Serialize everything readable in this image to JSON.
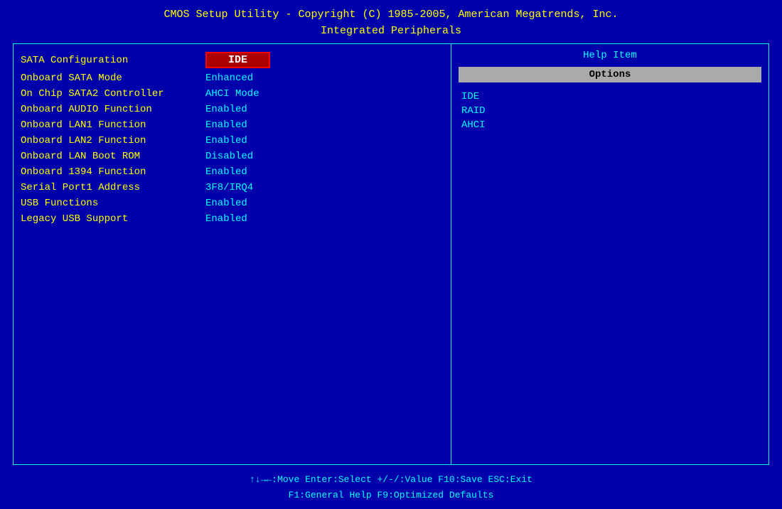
{
  "header": {
    "line1": "CMOS Setup Utility - Copyright (C) 1985-2005, American Megatrends, Inc.",
    "line2": "Integrated Peripherals"
  },
  "menu": {
    "items": [
      {
        "label": "SATA Configuration",
        "value": "IDE",
        "selected": true
      },
      {
        "label": "Onboard SATA Mode",
        "value": "Enhanced",
        "selected": false
      },
      {
        "label": "On Chip SATA2 Controller",
        "value": "AHCI Mode",
        "selected": false
      },
      {
        "label": "Onboard AUDIO Function",
        "value": "Enabled",
        "selected": false
      },
      {
        "label": "Onboard LAN1 Function",
        "value": "Enabled",
        "selected": false
      },
      {
        "label": "Onboard LAN2 Function",
        "value": "Enabled",
        "selected": false
      },
      {
        "label": "Onboard LAN Boot ROM",
        "value": "Disabled",
        "selected": false
      },
      {
        "label": "Onboard 1394 Function",
        "value": "Enabled",
        "selected": false
      },
      {
        "label": "Serial Port1 Address",
        "value": "3F8/IRQ4",
        "selected": false
      },
      {
        "label": "USB Functions",
        "value": "Enabled",
        "selected": false
      },
      {
        "label": "Legacy USB Support",
        "value": "Enabled",
        "selected": false
      }
    ]
  },
  "help_panel": {
    "title": "Help Item",
    "options_label": "Options",
    "options": [
      "IDE",
      "RAID",
      "AHCI"
    ]
  },
  "footer": {
    "line1_items": [
      "↑↓→←:Move",
      "Enter:Select",
      "+/-/:Value",
      "F10:Save",
      "ESC:Exit"
    ],
    "line2_items": [
      "F1:General Help",
      "F9:Optimized Defaults"
    ]
  }
}
